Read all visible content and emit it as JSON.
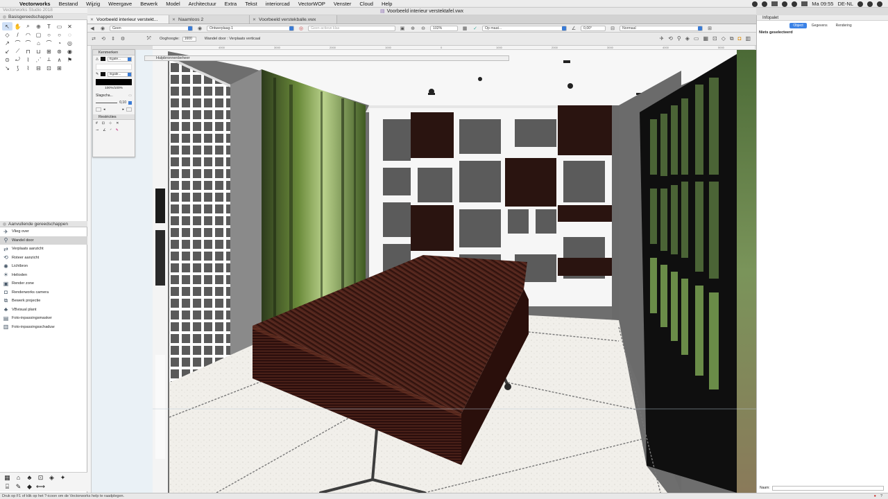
{
  "menubar": {
    "app": "Vectorworks",
    "items": [
      "Bestand",
      "Wijzig",
      "Weergave",
      "Bewerk",
      "Model",
      "Architectuur",
      "Extra",
      "Tekst",
      "interiorcad",
      "VectorWOP",
      "Venster",
      "Cloud",
      "Help"
    ],
    "clock": "Ma 09:55",
    "locale": "DE-NL"
  },
  "window": {
    "title": "Voorbeeld interieur verstektafel.vwx"
  },
  "doc_tabs": [
    {
      "label": "Voorbeeld interieur verstekt..."
    },
    {
      "label": "Naamloos 2"
    },
    {
      "label": "Voorbeeld verstekballe.vwx"
    }
  ],
  "viewbar": {
    "class": "Geen",
    "layer": "Ontwerplaag-1",
    "active_class": "Geen actieve klas",
    "zoom": "102%",
    "view": "Op maat...",
    "angle": "0,00°",
    "render": "Normaal"
  },
  "modebar": {
    "eye_height_label": "Ooghoogte:",
    "eye_height_value": "1600",
    "mode_label": "Wandel door : Verplaats verticaal"
  },
  "tool_palette": {
    "app_subtitle": "Vectorworks Studio 2018",
    "title": "Basisgereedschappen",
    "tools": [
      "↖",
      "✋",
      "⌕",
      "⊕",
      "T",
      "▭",
      "✕",
      "◇",
      "/",
      "◠",
      "▢",
      "○",
      "○",
      "◌",
      "↗",
      "⌒",
      "⌒",
      "⌂",
      "⌒",
      "◔",
      "◎",
      "↙",
      "⟋",
      "⊓",
      "⊔",
      "⊞",
      "⊛",
      "◉",
      "⊙",
      "⤾",
      "⌇",
      "⋰",
      "⟂",
      "∧",
      "⚑",
      "↘",
      "⟆",
      "⌇",
      "⊟",
      "⊡",
      "⊞",
      ""
    ]
  },
  "aanvullende": {
    "title": "Aanvullende gereedschappen",
    "items": [
      {
        "label": "Vlieg over",
        "icon": "fly-icon"
      },
      {
        "label": "Wandel door",
        "icon": "walk-icon"
      },
      {
        "label": "Verplaats aanzicht",
        "icon": "pan-view-icon"
      },
      {
        "label": "Roteer aanzicht",
        "icon": "rotate-view-icon"
      },
      {
        "label": "Lichtbron",
        "icon": "light-icon"
      },
      {
        "label": "Helioden",
        "icon": "sun-icon"
      },
      {
        "label": "Render zone",
        "icon": "render-zone-icon"
      },
      {
        "label": "Renderworks camera",
        "icon": "camera-icon"
      },
      {
        "label": "Bewerk projectie",
        "icon": "projection-icon"
      },
      {
        "label": "VBvisual plant",
        "icon": "plant-icon"
      },
      {
        "label": "Foto-inpassingsmasker",
        "icon": "photo-mask-icon"
      },
      {
        "label": "Foto-inpassingsschaduw",
        "icon": "photo-shadow-icon"
      }
    ]
  },
  "kenmerken": {
    "title": "Kenmerken",
    "fill_label": "Egale...",
    "pen_label": "Egale...",
    "opacity": "100%/100%",
    "shadow_label": "Slagscha...",
    "line_value": "0,10",
    "restrictions_title": "Restricties"
  },
  "hulpbronnen": {
    "title": "Hulpbronnenbeheer"
  },
  "ruler": {
    "ticks": [
      "4000",
      "3000",
      "2000",
      "1000",
      "0",
      "1000",
      "2000",
      "3000",
      "4000",
      "5000"
    ]
  },
  "infopalet": {
    "title": "Infopalet",
    "tabs": [
      "Object",
      "Gegevens",
      "Rendering"
    ],
    "active_tab": "Object",
    "message": "Niets geselecteerd",
    "naam_label": "Naam:"
  },
  "statusbar": {
    "text": "Druk op F1 of klik op het ?-icoon om de Vectorworks help te raadplegen."
  }
}
